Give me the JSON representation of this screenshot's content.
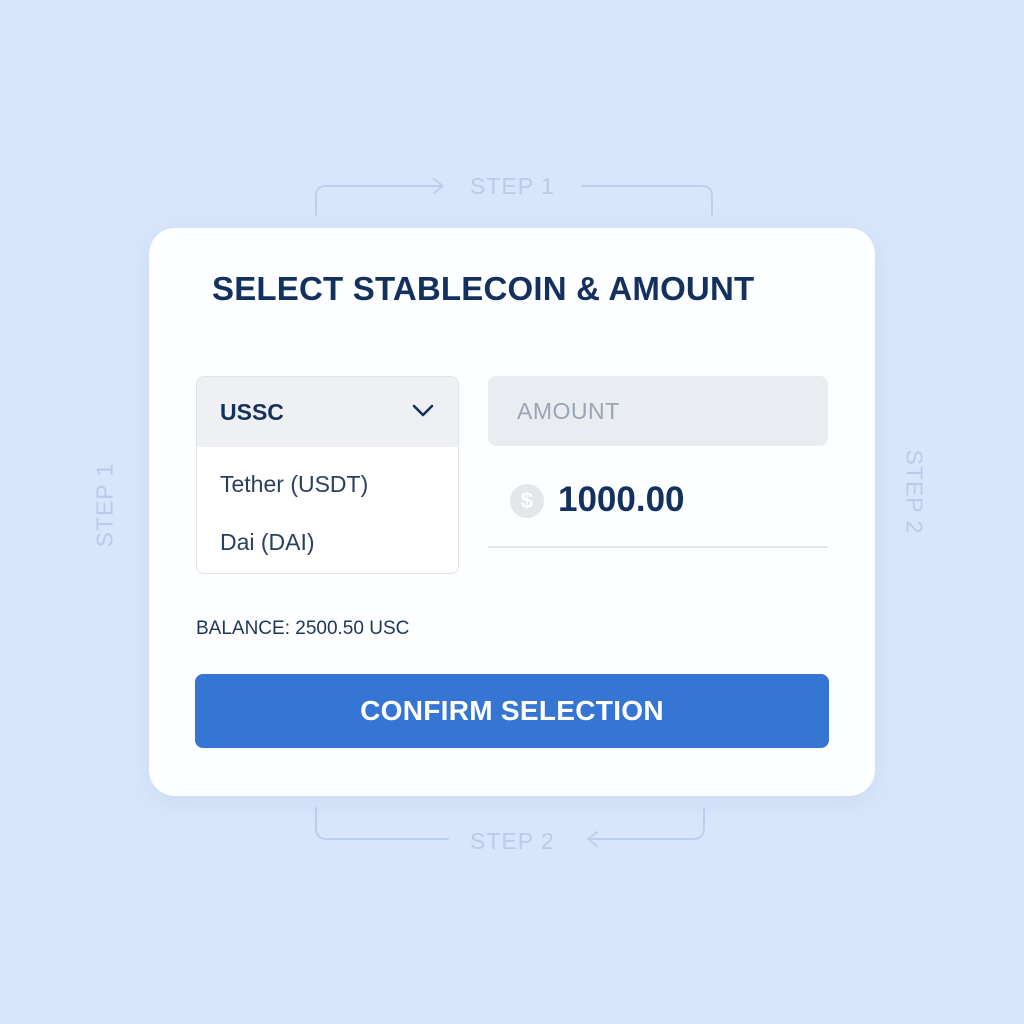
{
  "background_steps": {
    "top": "STEP 1",
    "bottom": "STEP 2",
    "left": "STEP 1",
    "right": "STEP 2"
  },
  "card": {
    "title": "SELECT STABLECOIN & AMOUNT",
    "dropdown": {
      "selected": "USSC",
      "options": [
        "Tether (USDT)",
        "Dai (DAI)"
      ],
      "icon": "chevron-down-icon"
    },
    "amount": {
      "placeholder": "AMOUNT",
      "value": "1000.00",
      "currency_symbol": "$",
      "icon": "dollar-coin-icon"
    },
    "balance": "BALANCE: 2500.50 USC",
    "confirm_label": "CONFIRM SELECTION"
  },
  "colors": {
    "background": "#d8e6fb",
    "card": "#fdfeff",
    "title": "#13315f",
    "accent": "#3575d4",
    "decoration": "#b9cbe8"
  }
}
